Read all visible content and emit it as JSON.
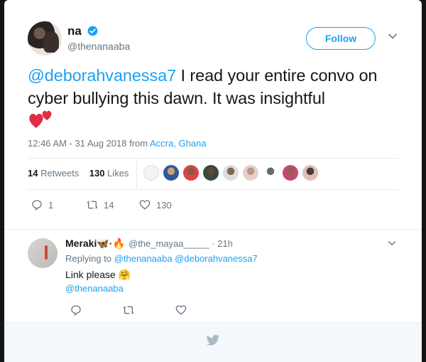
{
  "tweet": {
    "author_name": "na",
    "author_handle": "@thenanaaba",
    "follow_label": "Follow",
    "mention": "@deborahvanessa7",
    "text_rest": " I read your entire convo on cyber bullying this dawn. It was insightful",
    "timestamp": "12:46 AM - 31 Aug 2018 from ",
    "location": "Accra, Ghana",
    "retweets_count": "14",
    "retweets_label": "Retweets",
    "likes_count": "130",
    "likes_label": "Likes",
    "actions": {
      "replies": "1",
      "retweets": "14",
      "likes": "130"
    }
  },
  "reply": {
    "author_name": "Meraki",
    "handle_time": "@the_mayaa_____ · 21h",
    "replying_prefix": "Replying to",
    "replying_to": "@thenanaaba @deborahvanessa7",
    "text": "Link please",
    "link": "@thenanaaba"
  },
  "colors": {
    "accent": "#1da1f2",
    "heart": "#e0245e",
    "muted": "#657786"
  },
  "icons": [
    "verified-badge-icon",
    "chevron-down-icon",
    "hearts-emoji-icon",
    "reply-icon",
    "retweet-icon",
    "like-icon",
    "twitter-bird-icon",
    "butterfly-emoji-icon",
    "fire-emoji-icon",
    "hug-emoji-icon"
  ]
}
